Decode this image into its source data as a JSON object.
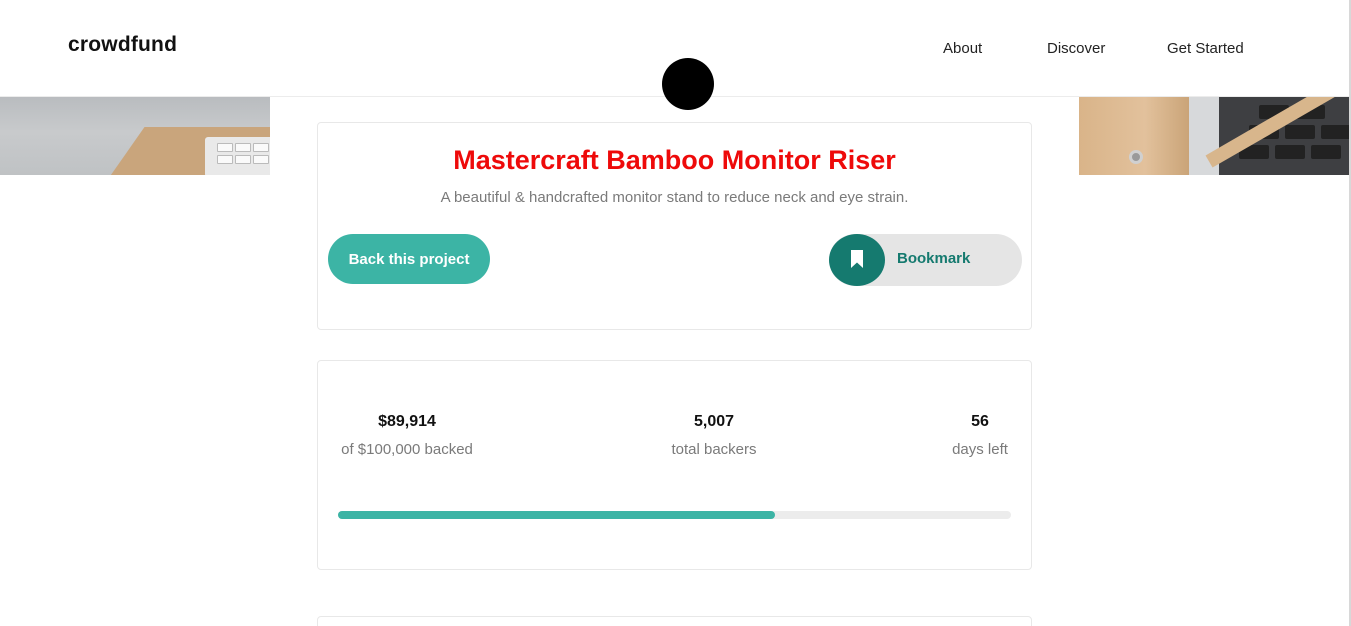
{
  "header": {
    "logo": "crowdfund",
    "nav": [
      {
        "label": "About"
      },
      {
        "label": "Discover"
      },
      {
        "label": "Get Started"
      }
    ]
  },
  "project": {
    "title": "Mastercraft Bamboo Monitor Riser",
    "description": "A beautiful & handcrafted monitor stand to reduce neck and eye strain.",
    "back_label": "Back this project",
    "bookmark_label": "Bookmark"
  },
  "stats": {
    "backed_amount": "$89,914",
    "backed_label": "of $100,000 backed",
    "backers_count": "5,007",
    "backers_label": "total backers",
    "days_left": "56",
    "days_label": "days left",
    "progress_fraction": 0.65
  },
  "colors": {
    "accent": "#3cb4a5",
    "accent_dark": "#157a6f",
    "title": "#ee0a0a"
  },
  "icons": {
    "bookmark": "bookmark-icon"
  }
}
